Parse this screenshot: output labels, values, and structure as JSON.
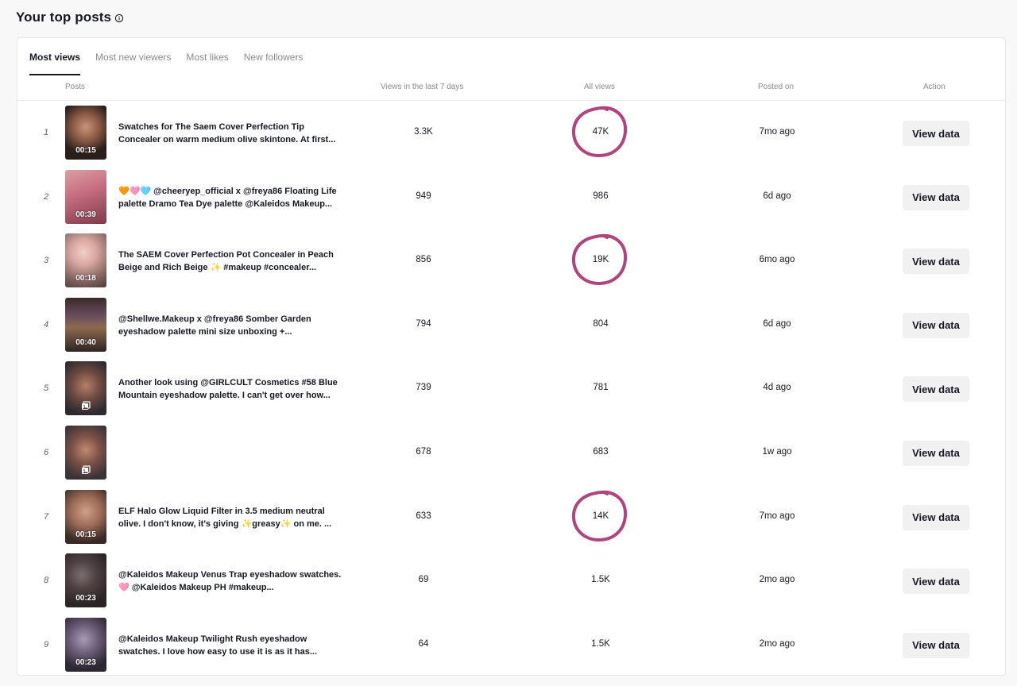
{
  "header": {
    "title": "Your top posts"
  },
  "tabs": [
    {
      "label": "Most views",
      "active": true
    },
    {
      "label": "Most new viewers",
      "active": false
    },
    {
      "label": "Most likes",
      "active": false
    },
    {
      "label": "New followers",
      "active": false
    }
  ],
  "columns": {
    "posts": "Posts",
    "views_7d": "Views in the last 7 days",
    "all_views": "All views",
    "posted_on": "Posted on",
    "action": "Action"
  },
  "rows": [
    {
      "rank": "1",
      "title_line1": "Swatches for The Saem Cover Perfection Tip",
      "title_line2": "Concealer on warm medium olive skintone. At first...",
      "views_7d": "3.3K",
      "all_views": "47K",
      "posted": "7mo ago",
      "duration": "00:15",
      "action": "View data",
      "highlighted": true
    },
    {
      "rank": "2",
      "title_line1": "🧡🩷🩵 @cheeryep_official x @freya86 Floating Life",
      "title_line2": "palette Dramo Tea Dye palette @Kaleidos Makeup...",
      "views_7d": "949",
      "all_views": "986",
      "posted": "6d ago",
      "duration": "00:39",
      "action": "View data",
      "highlighted": false
    },
    {
      "rank": "3",
      "title_line1": "The SAEM Cover Perfection Pot Concealer in Peach",
      "title_line2": "Beige and Rich Beige ✨ #makeup #concealer...",
      "views_7d": "856",
      "all_views": "19K",
      "posted": "6mo ago",
      "duration": "00:18",
      "action": "View data",
      "highlighted": true
    },
    {
      "rank": "4",
      "title_line1": "@Shellwe.Makeup x @freya86 Somber Garden",
      "title_line2": "eyeshadow palette mini size unboxing +...",
      "views_7d": "794",
      "all_views": "804",
      "posted": "6d ago",
      "duration": "00:40",
      "action": "View data",
      "highlighted": false
    },
    {
      "rank": "5",
      "title_line1": "Another look using @GIRLCULT Cosmetics #58 Blue",
      "title_line2": "Mountain eyeshadow palette. I can't get over how...",
      "views_7d": "739",
      "all_views": "781",
      "posted": "4d ago",
      "duration": "",
      "action": "View data",
      "highlighted": false
    },
    {
      "rank": "6",
      "title_line1": "",
      "title_line2": "",
      "views_7d": "678",
      "all_views": "683",
      "posted": "1w ago",
      "duration": "",
      "action": "View data",
      "highlighted": false
    },
    {
      "rank": "7",
      "title_line1": "ELF Halo Glow Liquid Filter in 3.5 medium neutral",
      "title_line2": "olive. I don't know, it's giving ✨greasy✨ on me. ...",
      "views_7d": "633",
      "all_views": "14K",
      "posted": "7mo ago",
      "duration": "00:15",
      "action": "View data",
      "highlighted": true
    },
    {
      "rank": "8",
      "title_line1": "@Kaleidos Makeup Venus Trap eyeshadow swatches.",
      "title_line2": "🩷 @Kaleidos Makeup PH #makeup...",
      "views_7d": "69",
      "all_views": "1.5K",
      "posted": "2mo ago",
      "duration": "00:23",
      "action": "View data",
      "highlighted": false
    },
    {
      "rank": "9",
      "title_line1": "@Kaleidos Makeup Twilight Rush eyeshadow",
      "title_line2": "swatches. I love how easy to use it is as it has...",
      "views_7d": "64",
      "all_views": "1.5K",
      "posted": "2mo ago",
      "duration": "00:23",
      "action": "View data",
      "highlighted": false
    }
  ],
  "colors": {
    "annotation_circle": "#b0457e",
    "button_bg": "#f1f1f2"
  }
}
